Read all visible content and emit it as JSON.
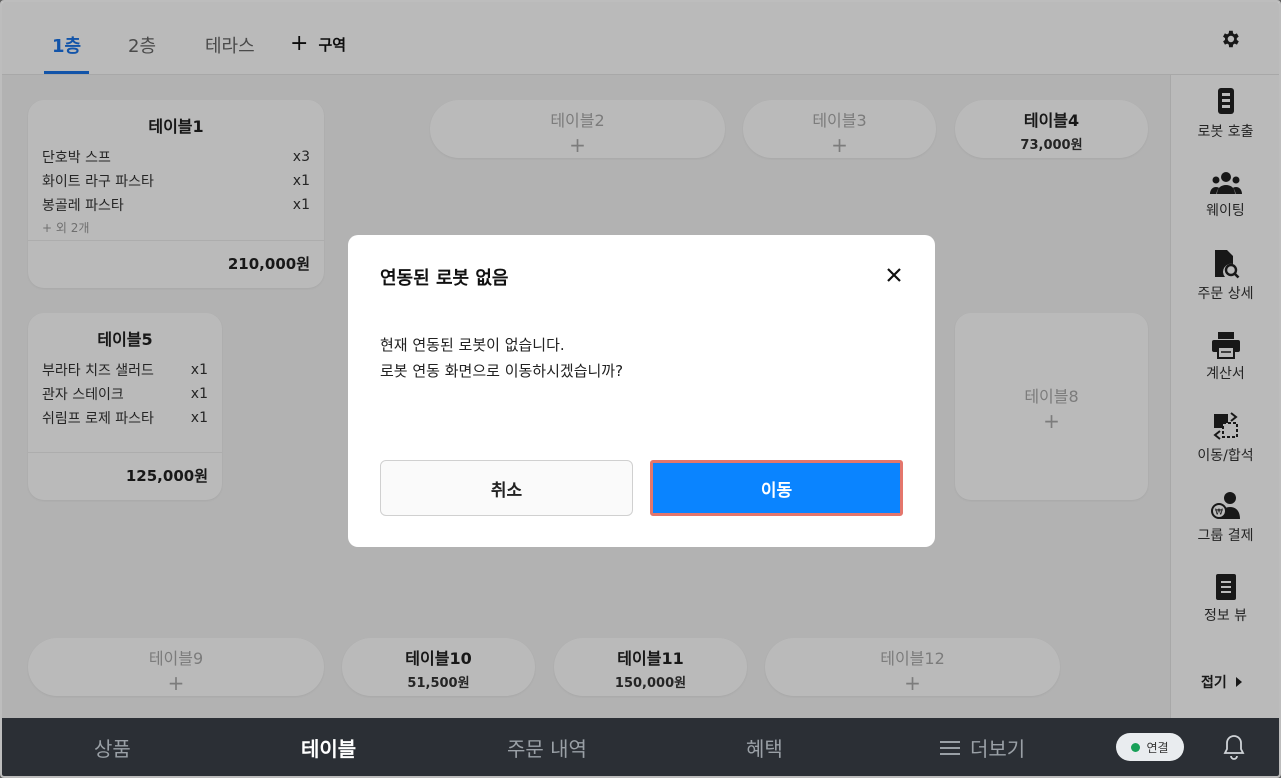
{
  "tabs": [
    {
      "label": "1층",
      "active": true
    },
    {
      "label": "2층",
      "active": false
    },
    {
      "label": "테라스",
      "active": false
    }
  ],
  "add_zone_label": "구역",
  "tables": {
    "t1": {
      "title": "테이블1",
      "items": [
        {
          "name": "단호박 스프",
          "qty": "x3"
        },
        {
          "name": "화이트 라구 파스타",
          "qty": "x1"
        },
        {
          "name": "봉골레 파스타",
          "qty": "x1"
        }
      ],
      "more": "+ 외 2개",
      "total": "210,000원"
    },
    "t2": {
      "title": "테이블2",
      "plus": "+"
    },
    "t3": {
      "title": "테이블3",
      "plus": "+"
    },
    "t4": {
      "title": "테이블4",
      "price": "73,000원"
    },
    "t5": {
      "title": "테이블5",
      "items": [
        {
          "name": "부라타 치즈 샐러드",
          "qty": "x1"
        },
        {
          "name": "관자 스테이크",
          "qty": "x1"
        },
        {
          "name": "쉬림프 로제 파스타",
          "qty": "x1"
        }
      ],
      "total": "125,000원"
    },
    "t8": {
      "title": "테이블8",
      "plus": "+"
    },
    "t9": {
      "title": "테이블9",
      "plus": "+"
    },
    "t10": {
      "title": "테이블10",
      "price": "51,500원"
    },
    "t11": {
      "title": "테이블11",
      "price": "150,000원"
    },
    "t12": {
      "title": "테이블12",
      "plus": "+"
    }
  },
  "sidebar": {
    "items": [
      {
        "label": "로봇 호출",
        "icon": "robot-icon"
      },
      {
        "label": "웨이팅",
        "icon": "people-icon"
      },
      {
        "label": "주문 상세",
        "icon": "document-search-icon"
      },
      {
        "label": "계산서",
        "icon": "printer-icon"
      },
      {
        "label": "이동/합석",
        "icon": "move-merge-icon"
      },
      {
        "label": "그룹 결제",
        "icon": "group-payment-icon"
      },
      {
        "label": "정보 뷰",
        "icon": "info-document-icon"
      }
    ],
    "fold_label": "접기"
  },
  "bottom_nav": {
    "items": [
      {
        "label": "상품",
        "active": false
      },
      {
        "label": "테이블",
        "active": true
      },
      {
        "label": "주문 내역",
        "active": false
      },
      {
        "label": "혜택",
        "active": false
      },
      {
        "label": "더보기",
        "active": false
      }
    ],
    "connection_label": "연결"
  },
  "modal": {
    "title": "연동된 로봇 없음",
    "line1": "현재 연동된 로봇이 없습니다.",
    "line2": "로봇 연동 화면으로 이동하시겠습니까?",
    "cancel_label": "취소",
    "confirm_label": "이동"
  },
  "colors": {
    "accent": "#1a73e8",
    "confirm_button": "#0a84ff",
    "highlight_border": "#e4766c",
    "bottom_nav_bg": "#2b2f35",
    "connected_dot": "#18a058"
  }
}
